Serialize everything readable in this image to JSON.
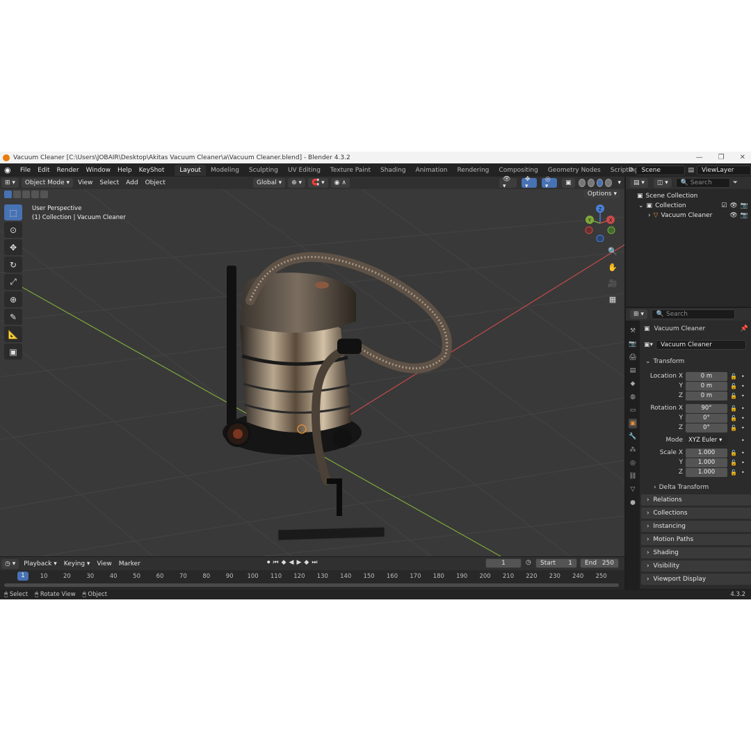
{
  "window": {
    "title": "Vacuum Cleaner [C:\\Users\\JOBAIR\\Desktop\\Akitas Vacuum Cleaner\\a\\Vacuum Cleaner.blend] - Blender 4.3.2",
    "minimize": "—",
    "maximize": "❐",
    "close": "✕"
  },
  "menu": {
    "items": [
      "File",
      "Edit",
      "Render",
      "Window",
      "Help",
      "KeyShot"
    ],
    "tabs": [
      "Layout",
      "Modeling",
      "Sculpting",
      "UV Editing",
      "Texture Paint",
      "Shading",
      "Animation",
      "Rendering",
      "Compositing",
      "Geometry Nodes",
      "Scripting"
    ],
    "active_tab": "Layout",
    "add_tab": "+",
    "scene": "Scene",
    "view_layer": "ViewLayer"
  },
  "viewport_header": {
    "mode": "Object Mode",
    "menus": [
      "View",
      "Select",
      "Add",
      "Object"
    ],
    "orientation": "Global",
    "options": "Options"
  },
  "viewport": {
    "perspective": "User Perspective",
    "collection_info": "(1) Collection | Vacuum Cleaner",
    "gizmo": {
      "x": "X",
      "y": "Y",
      "z": "Z"
    }
  },
  "timeline": {
    "menus": [
      "Playback",
      "Keying",
      "View",
      "Marker"
    ],
    "current_frame": "1",
    "start_label": "Start",
    "start": "1",
    "end_label": "End",
    "end": "250",
    "ticks": [
      "10",
      "20",
      "30",
      "40",
      "50",
      "60",
      "70",
      "80",
      "90",
      "100",
      "110",
      "120",
      "130",
      "140",
      "150",
      "160",
      "170",
      "180",
      "190",
      "200",
      "210",
      "220",
      "230",
      "240",
      "250"
    ]
  },
  "statusbar": {
    "items": [
      "Select",
      "Rotate View",
      "Object"
    ],
    "version": "4.3.2"
  },
  "outliner": {
    "search_placeholder": "Search",
    "scene_collection": "Scene Collection",
    "collection": "Collection",
    "object": "Vacuum Cleaner"
  },
  "properties": {
    "search_placeholder": "Search",
    "object_name": "Vacuum Cleaner",
    "object_field": "Vacuum Cleaner",
    "transform": "Transform",
    "location": {
      "label_x": "Location X",
      "label_y": "Y",
      "label_z": "Z",
      "x": "0 m",
      "y": "0 m",
      "z": "0 m"
    },
    "rotation": {
      "label_x": "Rotation X",
      "label_y": "Y",
      "label_z": "Z",
      "x": "90°",
      "y": "0°",
      "z": "0°"
    },
    "mode_label": "Mode",
    "mode_value": "XYZ Euler",
    "scale": {
      "label_x": "Scale X",
      "label_y": "Y",
      "label_z": "Z",
      "x": "1.000",
      "y": "1.000",
      "z": "1.000"
    },
    "delta_transform": "Delta Transform",
    "sections": [
      "Relations",
      "Collections",
      "Instancing",
      "Motion Paths",
      "Shading",
      "Visibility",
      "Viewport Display"
    ]
  },
  "colors": {
    "accent": "#4772b3",
    "object_orange": "#e8903c",
    "x_axis": "#c94a4a",
    "y_axis": "#7fa93a",
    "z_axis": "#4a7fd6"
  }
}
